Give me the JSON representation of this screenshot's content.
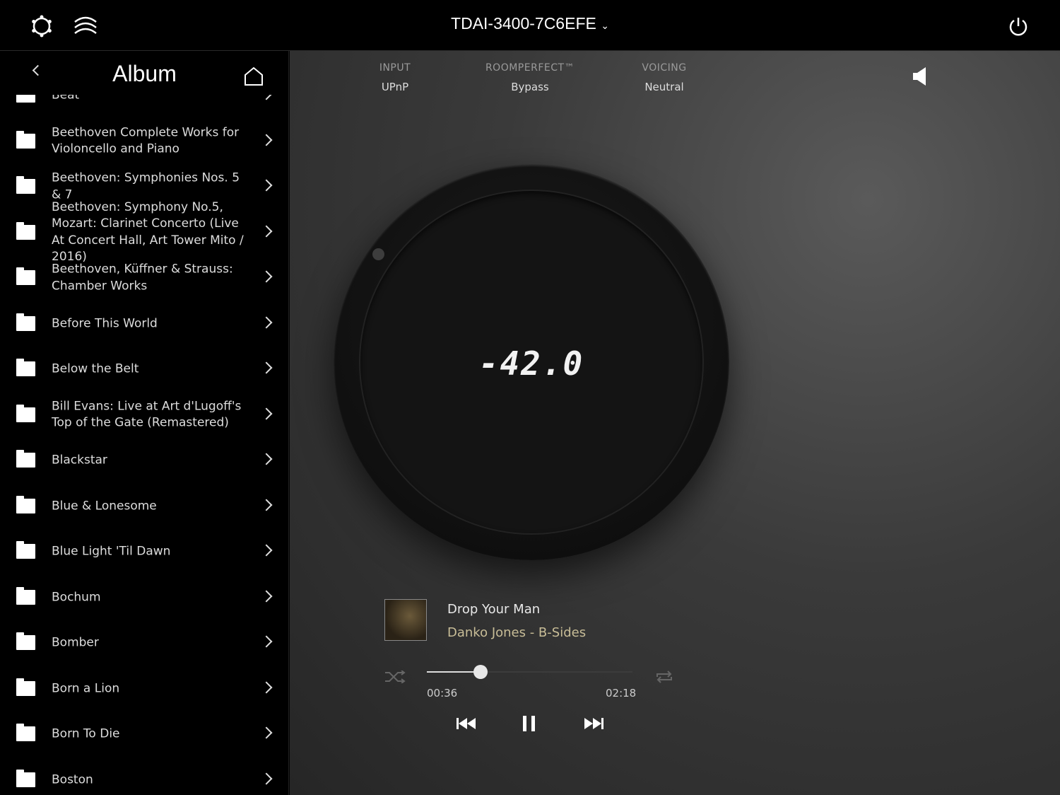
{
  "topbar": {
    "device_name": "TDAI-3400-7C6EFE",
    "icons": [
      "gear-icon",
      "waves-icon",
      "chevron-down-icon",
      "power-icon"
    ]
  },
  "sidebar": {
    "title": "Album",
    "items": [
      {
        "label": "Beat"
      },
      {
        "label": "Beethoven Complete Works for Violoncello and Piano"
      },
      {
        "label": "Beethoven: Symphonies Nos. 5 & 7"
      },
      {
        "label": "Beethoven: Symphony No.5, Mozart: Clarinet Concerto (Live At Concert Hall, Art Tower Mito / 2016)"
      },
      {
        "label": "Beethoven, Küffner & Strauss: Chamber Works"
      },
      {
        "label": "Before This World"
      },
      {
        "label": "Below the Belt"
      },
      {
        "label": "Bill Evans: Live at Art d'Lugoff's Top of the Gate (Remastered)"
      },
      {
        "label": "Blackstar"
      },
      {
        "label": "Blue & Lonesome"
      },
      {
        "label": "Blue Light 'Til Dawn"
      },
      {
        "label": "Bochum"
      },
      {
        "label": "Bomber"
      },
      {
        "label": "Born a Lion"
      },
      {
        "label": "Born To Die"
      },
      {
        "label": "Boston"
      }
    ]
  },
  "status": {
    "input": {
      "label": "INPUT",
      "value": "UPnP"
    },
    "roomperfect": {
      "label": "ROOMPERFECT™",
      "value": "Bypass"
    },
    "voicing": {
      "label": "VOICING",
      "value": "Neutral"
    }
  },
  "volume": {
    "display": "-42.0"
  },
  "now_playing": {
    "title": "Drop Your Man",
    "artist_album": "Danko Jones - B-Sides",
    "elapsed": "00:36",
    "duration": "02:18",
    "progress": 0.26,
    "shuffle": false,
    "repeat": false,
    "playing": true
  },
  "colors": {
    "accent_artist": "#c8bd97",
    "background": "#000000"
  }
}
